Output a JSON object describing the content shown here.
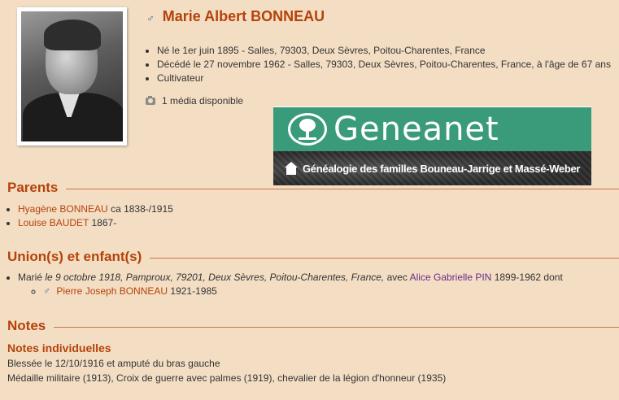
{
  "person": {
    "name": "Marie Albert BONNEAU",
    "sex_symbol": "♂",
    "birth": "Né le 1er juin 1895 - Salles, 79303, Deux Sèvres, Poitou-Charentes, France",
    "death": "Décédé le 27 novembre 1962 - Salles, 79303, Deux Sèvres, Poitou-Charentes, France, à l'âge de 67 ans",
    "occupation": "Cultivateur",
    "media": "1 média disponible"
  },
  "banner": {
    "brand": "Geneanet",
    "tagline": "Généalogie des familles Bouneau-Jarrige et Massé-Weber"
  },
  "parents": {
    "title": "Parents",
    "items": [
      {
        "name": "Hyagène BONNEAU",
        "dates": "ca 1838-/1915"
      },
      {
        "name": "Louise BAUDET",
        "dates": "1867-"
      }
    ]
  },
  "unions": {
    "title": "Union(s) et enfant(s)",
    "prefix": "Marié",
    "details": "le 9 octobre 1918, Pamproux, 79201, Deux Sèvres, Poitou-Charentes, France,",
    "avec": "avec",
    "spouse": "Alice Gabrielle PIN",
    "spouse_dates": "1899-1962 dont",
    "children": [
      {
        "sex_symbol": "♂",
        "name": "Pierre Joseph BONNEAU",
        "dates": "1921-1985"
      }
    ]
  },
  "notes": {
    "title": "Notes",
    "subtitle": "Notes individuelles",
    "lines": [
      "Blessée le 12/10/1916 et amputé du bras gauche",
      "Médaille militaire (1913), Croix de guerre avec palmes (1919), chevalier de la légion d'honneur (1935)"
    ]
  },
  "colors": {
    "background": "#f3dec4",
    "accent": "#b5420a",
    "spouse_link": "#6a2a8a",
    "banner_green": "#3a9b7a"
  }
}
